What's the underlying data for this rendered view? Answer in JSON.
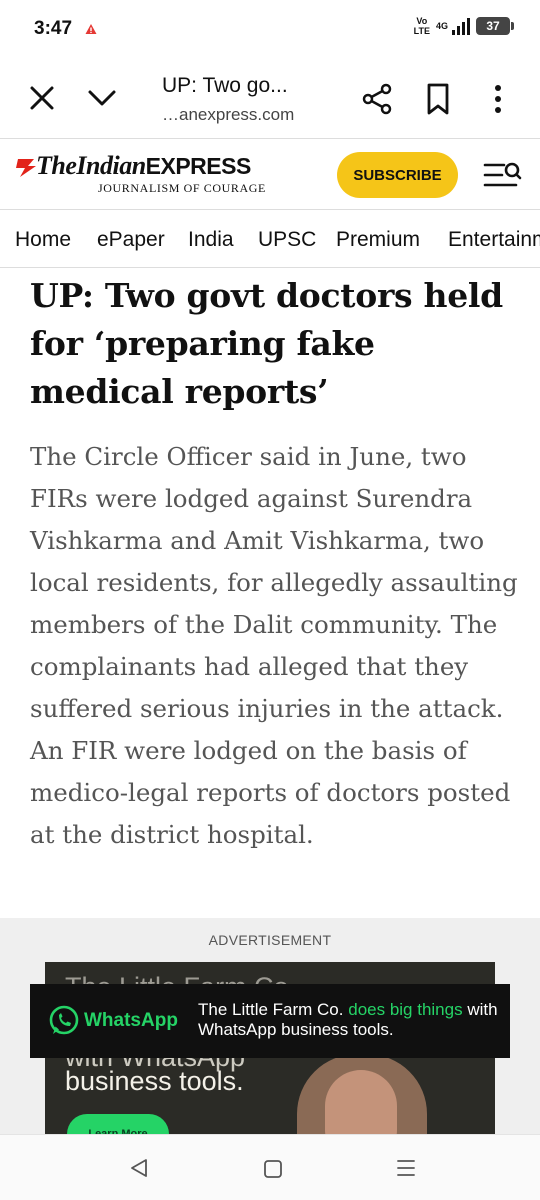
{
  "status_bar": {
    "time": "3:47",
    "volte_top": "Vo",
    "volte_bottom": "LTE",
    "network": "4G",
    "battery": "37"
  },
  "browser": {
    "tab_title": "UP: Two go...",
    "url": "…anexpress.com",
    "icons": [
      "close-icon",
      "chevron-down-icon",
      "share-icon",
      "bookmark-icon",
      "more-vert-icon"
    ]
  },
  "site_header": {
    "logo_the": "The",
    "logo_indian": "Indian",
    "logo_express": "EXPRESS",
    "tagline": "JOURNALISM OF COURAGE",
    "subscribe_label": "SUBSCRIBE",
    "accent_color": "#f5c518",
    "brand_red": "#e2231a"
  },
  "nav": {
    "items": [
      {
        "label": "Home"
      },
      {
        "label": "ePaper"
      },
      {
        "label": "India"
      },
      {
        "label": "UPSC"
      },
      {
        "label": "Premium"
      },
      {
        "label": "Entertainm"
      }
    ]
  },
  "article": {
    "headline": "UP: Two govt doctors held for ‘preparing fake medical reports’",
    "summary": "The Circle Officer said in June, two FIRs were lodged against Surendra Vishkarma and Amit Vishkarma, two local residents, for allegedly assaulting members of the Dalit community. The complainants had alleged that they suffered serious injuries in the attack. An FIR were lodged on the basis of medico-legal reports of doctors posted at the district hospital."
  },
  "ad": {
    "label": "ADVERTISEMENT",
    "ghost_line1": "The Little Farm Co.",
    "ghost_line2": "with WhatsApp",
    "headline": "business tools.",
    "cta": "Learn More",
    "banner_brand": "WhatsApp",
    "banner_text_1": "The Little Farm Co.",
    "banner_text_accent": "does big things",
    "banner_text_2": "with WhatsApp business tools.",
    "whatsapp_green": "#25d366"
  },
  "system_nav": {
    "icons": [
      "back-icon",
      "home-icon",
      "recents-icon"
    ]
  }
}
